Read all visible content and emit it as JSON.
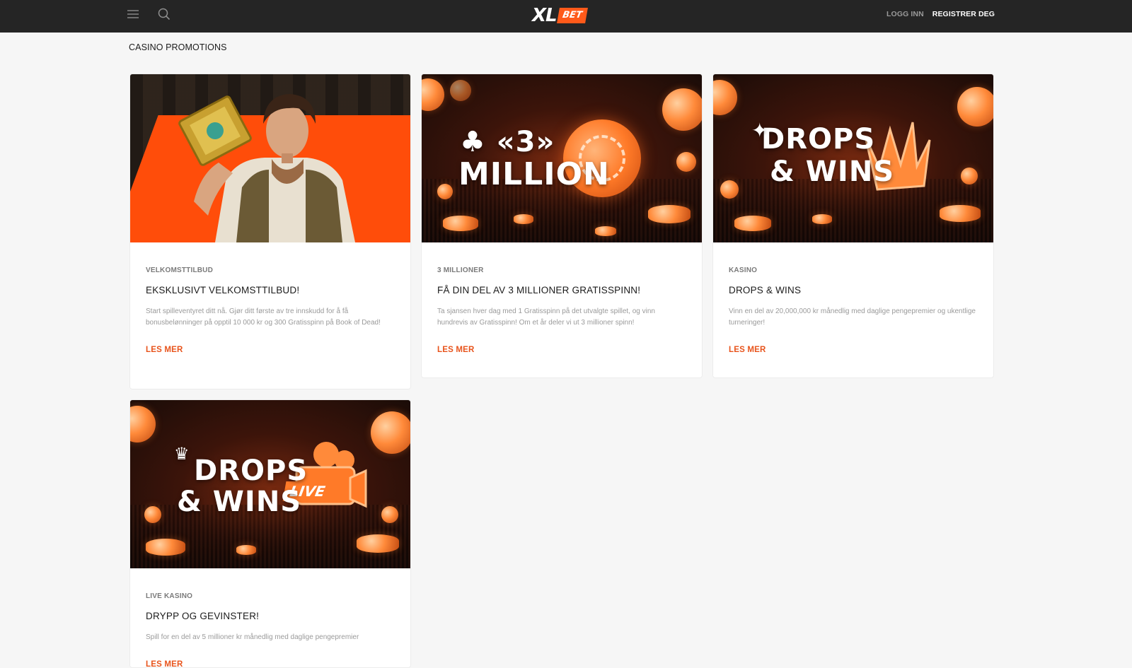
{
  "header": {
    "menu_icon": "hamburger-menu-icon",
    "search_icon": "search-icon",
    "logo_xl": "XL",
    "logo_bet": "BET",
    "login_label": "LOGG INN",
    "register_label": "REGISTRER DEG",
    "colors": {
      "background": "#252525",
      "brand": "#ff5a1a"
    }
  },
  "page": {
    "title": "CASINO PROMOTIONS"
  },
  "promotions": [
    {
      "category": "VELKOMSTTILBUD",
      "title": "EKSKLUSIVT VELKOMSTTILBUD!",
      "description": "Start spilleventyret ditt nå. Gjør ditt første av tre innskudd for å få bonusbelønninger på opptil 10 000 kr og 300 Gratisspinn på Book of Dead!",
      "link": "LES MER"
    },
    {
      "category": "3 MILLIONER",
      "title": "FÅ DIN DEL AV 3 MILLIONER GRATISSPINN!",
      "description": "Ta sjansen hver dag med 1 Gratisspinn på det utvalgte spillet, og vinn hundrevis av Gratisspinn! Om et år deler vi ut 3 millioner spinn!",
      "link": "LES MER",
      "banner": {
        "line1": "♣ «3»",
        "line2": "MILLION"
      }
    },
    {
      "category": "KASINO",
      "title": "DROPS & WINS",
      "description": "Vinn en del av 20,000,000 kr månedlig med daglige pengepremier og ukentlige turneringer!",
      "link": "LES MER",
      "banner": {
        "line1": "DROPS",
        "line2": "& WINS"
      }
    },
    {
      "category": "LIVE KASINO",
      "title": "DRYPP OG GEVINSTER!",
      "description": "Spill for en del av 5 millioner kr månedlig med daglige pengepremier",
      "link": "LES MER",
      "banner": {
        "line1": "DROPS",
        "line2": "& WINS",
        "tag": "LIVE"
      }
    }
  ],
  "accent_color": "#e8541c"
}
